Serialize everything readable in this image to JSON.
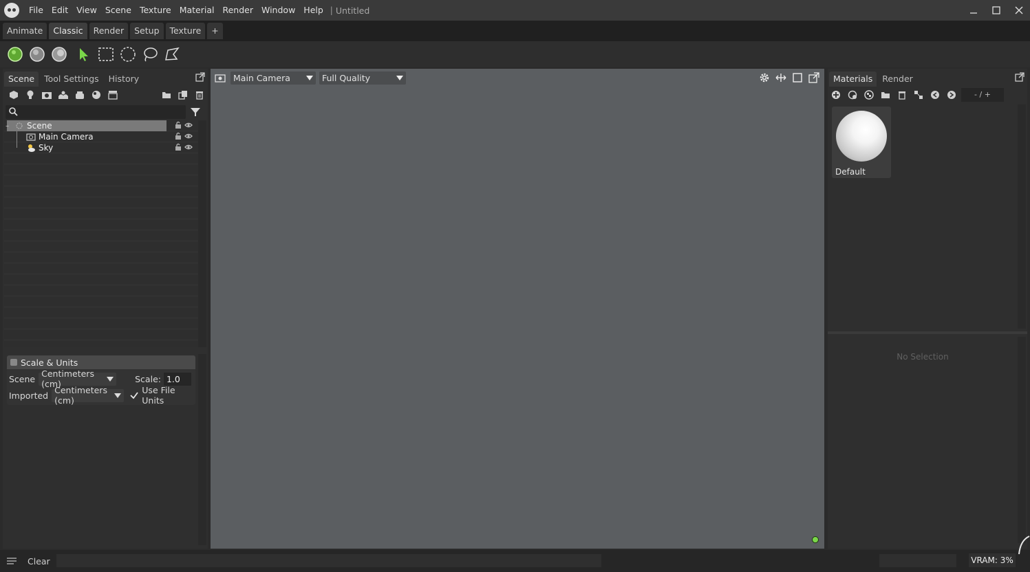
{
  "menu": {
    "items": [
      "File",
      "Edit",
      "View",
      "Scene",
      "Texture",
      "Material",
      "Render",
      "Window",
      "Help"
    ],
    "separator": "|",
    "doc_title": "Untitled"
  },
  "workspace_tabs": [
    {
      "label": "Animate",
      "active": false
    },
    {
      "label": "Classic",
      "active": true
    },
    {
      "label": "Render",
      "active": false
    },
    {
      "label": "Setup",
      "active": false
    },
    {
      "label": "Texture",
      "active": false
    },
    {
      "label": "+",
      "active": false
    }
  ],
  "left_panel": {
    "tabs": [
      "Scene",
      "Tool Settings",
      "History"
    ],
    "search_placeholder": "",
    "tree": [
      {
        "label": "Scene",
        "selected": true
      },
      {
        "label": "Main Camera",
        "selected": false
      },
      {
        "label": "Sky",
        "selected": false
      }
    ],
    "scale_units": {
      "title": "Scale & Units",
      "scene_label": "Scene",
      "scene_unit": "Centimeters (cm)",
      "scale_label": "Scale:",
      "scale_value": "1.0",
      "imported_label": "Imported",
      "imported_unit": "Centimeters (cm)",
      "use_file_units_label": "Use File Units",
      "use_file_units_checked": true
    }
  },
  "viewport": {
    "camera": "Main Camera",
    "quality": "Full Quality"
  },
  "right_panel": {
    "tabs": [
      "Materials",
      "Render"
    ],
    "zoom_label": "- / +",
    "materials": [
      {
        "name": "Default"
      }
    ],
    "no_selection": "No Selection"
  },
  "status": {
    "clear_label": "Clear",
    "vram": "VRAM: 3%"
  },
  "colors": {
    "accent_green": "#7bd64a",
    "viewport_bg": "#5b5e61"
  }
}
